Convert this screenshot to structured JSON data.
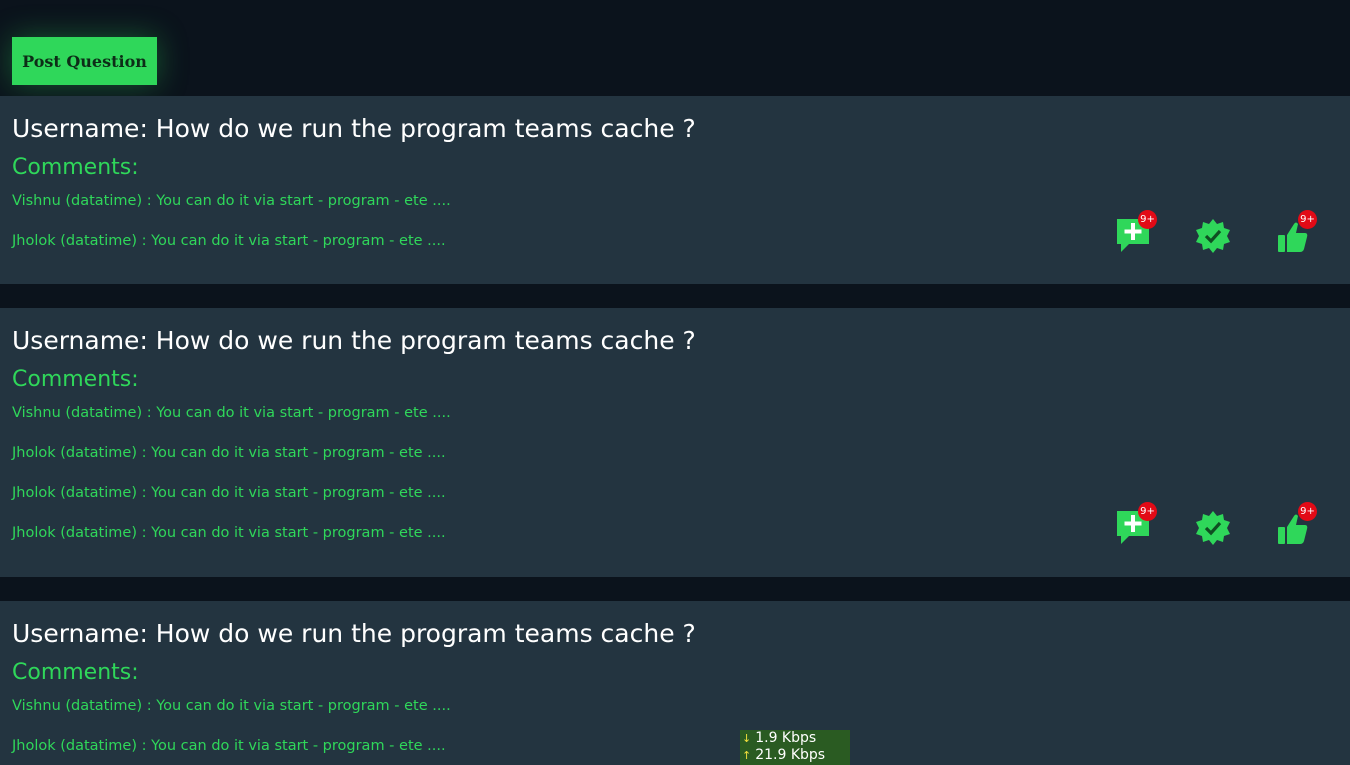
{
  "toolbar": {
    "post_label": "Post Question"
  },
  "cards": [
    {
      "question": "Username: How do we run the program teams cache ?",
      "comments_label": "Comments:",
      "comments": [
        "Vishnu (datatime) : You can do it via start - program - ete ....",
        "Jholok (datatime) : You can do it via start - program - ete ...."
      ],
      "comment_badge": "9+",
      "like_badge": "9+"
    },
    {
      "question": "Username: How do we run the program teams cache ?",
      "comments_label": "Comments:",
      "comments": [
        "Vishnu (datatime) : You can do it via start - program - ete ....",
        "Jholok (datatime) : You can do it via start - program - ete ....",
        "Jholok (datatime) : You can do it via start - program - ete ....",
        "Jholok (datatime) : You can do it via start - program - ete ...."
      ],
      "comment_badge": "9+",
      "like_badge": "9+"
    },
    {
      "question": "Username: How do we run the program teams cache ?",
      "comments_label": "Comments:",
      "comments": [
        "Vishnu (datatime) : You can do it via start - program - ete ....",
        "Jholok (datatime) : You can do it via start - program - ete ...."
      ]
    }
  ],
  "network_monitor": {
    "download": "1.9 Kbps",
    "upload": "21.9 Kbps"
  },
  "colors": {
    "background": "#0b131c",
    "card": "#233440",
    "accent": "#2fd75a",
    "badge": "#e20a16"
  },
  "icons": [
    "add-comment-icon",
    "verified-icon",
    "thumbs-up-icon"
  ]
}
